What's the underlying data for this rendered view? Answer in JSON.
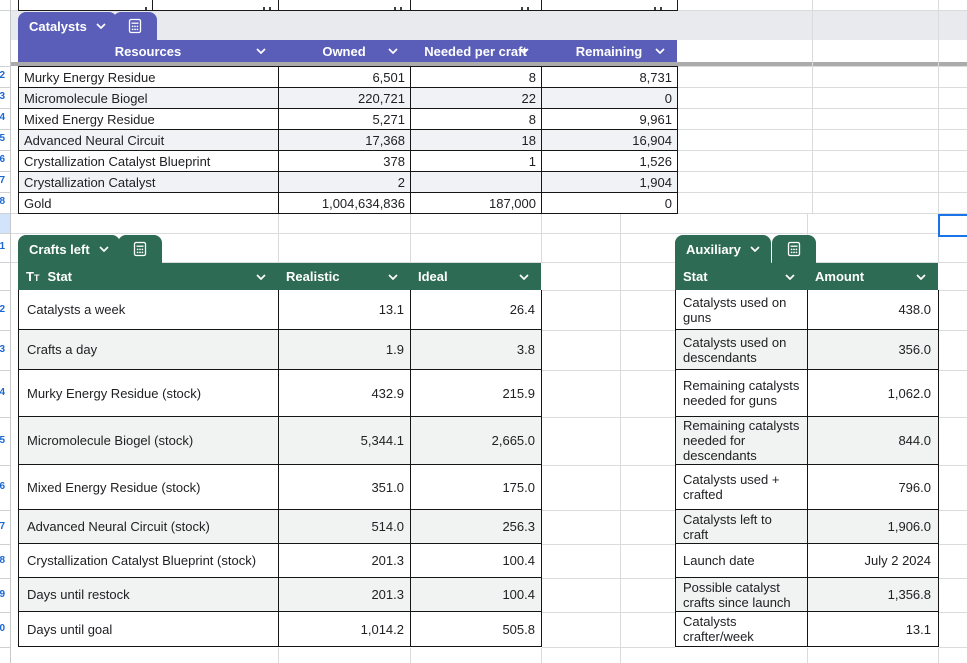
{
  "colors": {
    "catalysts_accent": "#5a5eb9",
    "green_accent": "#2e6b54",
    "selection_blue": "#1a73e8",
    "banding_catalysts": "#f1f2f6",
    "banding_green": "#f0f3f1"
  },
  "tables": {
    "catalysts": {
      "name": "Catalysts",
      "columns": [
        "Resources",
        "Owned",
        "Needed per craft",
        "Remaining"
      ],
      "rows": [
        [
          "Murky Energy Residue",
          "6,501",
          "8",
          "8,731"
        ],
        [
          "Micromolecule Biogel",
          "220,721",
          "22",
          "0"
        ],
        [
          "Mixed Energy Residue",
          "5,271",
          "8",
          "9,961"
        ],
        [
          "Advanced Neural Circuit",
          "17,368",
          "18",
          "16,904"
        ],
        [
          "Crystallization Catalyst Blueprint",
          "378",
          "1",
          "1,526"
        ],
        [
          "Crystallization Catalyst",
          "2",
          "",
          "1,904"
        ],
        [
          "Gold",
          "1,004,634,836",
          "187,000",
          "0"
        ]
      ]
    },
    "crafts_left": {
      "name": "Crafts left",
      "columns": [
        "Stat",
        "Realistic",
        "Ideal"
      ],
      "rows": [
        [
          "Catalysts a week",
          "13.1",
          "26.4"
        ],
        [
          "Crafts a day",
          "1.9",
          "3.8"
        ],
        [
          "Murky Energy Residue (stock)",
          "432.9",
          "215.9"
        ],
        [
          "Micromolecule Biogel (stock)",
          "5,344.1",
          "2,665.0"
        ],
        [
          "Mixed Energy Residue (stock)",
          "351.0",
          "175.0"
        ],
        [
          "Advanced Neural Circuit (stock)",
          "514.0",
          "256.3"
        ],
        [
          "Crystallization Catalyst Blueprint (stock)",
          "201.3",
          "100.4"
        ],
        [
          "Days until restock",
          "201.3",
          "100.4"
        ],
        [
          "Days until goal",
          "1,014.2",
          "505.8"
        ]
      ]
    },
    "auxiliary": {
      "name": "Auxiliary",
      "columns": [
        "Stat",
        "Amount"
      ],
      "rows": [
        [
          "Catalysts used on guns",
          "438.0"
        ],
        [
          "Catalysts used on descendants",
          "356.0"
        ],
        [
          "Remaining catalysts needed for guns",
          "1,062.0"
        ],
        [
          "Remaining catalysts needed for descendants",
          "844.0"
        ],
        [
          "Catalysts used + crafted",
          "796.0"
        ],
        [
          "Catalysts left to craft",
          "1,906.0"
        ],
        [
          "Launch date",
          "July 2 2024"
        ],
        [
          "Possible catalyst crafts since launch",
          "1,356.8"
        ],
        [
          "Catalysts crafter/week",
          "13.1"
        ]
      ]
    }
  }
}
